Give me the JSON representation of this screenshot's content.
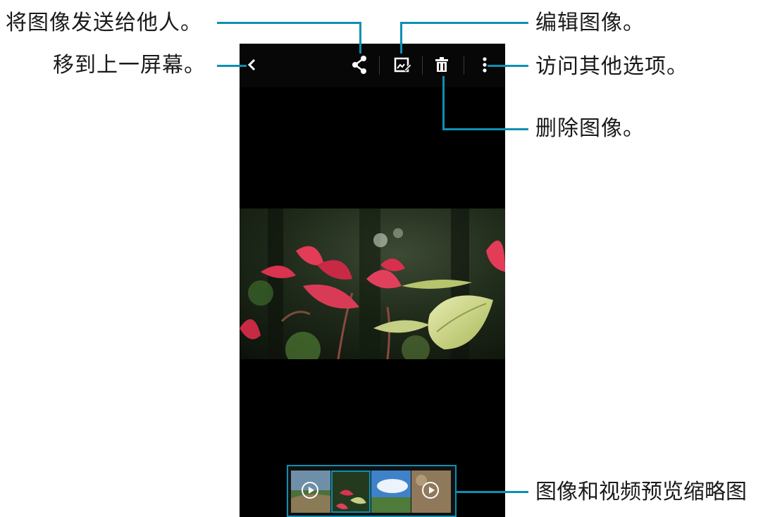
{
  "annotations": {
    "share": "将图像发送给他人。",
    "back": "移到上一屏幕。",
    "edit": "编辑图像。",
    "more": "访问其他选项。",
    "delete": "删除图像。",
    "thumbnails": "图像和视频预览缩略图"
  },
  "toolbar": {
    "icons": [
      "back-icon",
      "share-icon",
      "edit-icon",
      "delete-icon",
      "more-options-icon"
    ]
  },
  "thumbnail_strip": {
    "items": [
      {
        "type": "video",
        "icon": "play-icon"
      },
      {
        "type": "image"
      },
      {
        "type": "image"
      },
      {
        "type": "video",
        "icon": "play-icon"
      }
    ]
  },
  "colors": {
    "callout_line": "#0d8fb3",
    "screen_background": "#000000",
    "page_background": "#ffffff"
  }
}
